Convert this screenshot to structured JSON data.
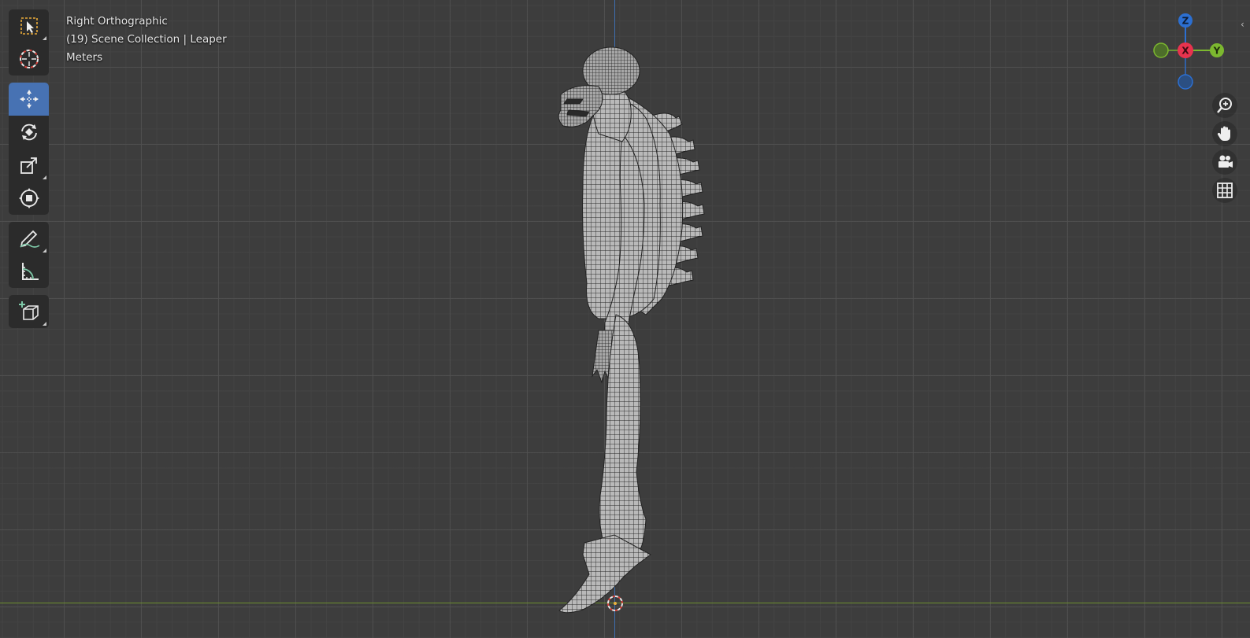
{
  "viewport": {
    "view_name": "Right Orthographic",
    "collection_info": "(19) Scene Collection | Leaper",
    "units": "Meters",
    "background": "#3d3d3d"
  },
  "toolbar": {
    "tools": [
      {
        "name": "select-box",
        "icon": "select-box-icon"
      },
      {
        "name": "cursor",
        "icon": "cursor-icon"
      },
      {
        "name": "move",
        "icon": "move-icon",
        "active": true
      },
      {
        "name": "rotate",
        "icon": "rotate-icon"
      },
      {
        "name": "scale",
        "icon": "scale-icon"
      },
      {
        "name": "transform",
        "icon": "transform-icon"
      },
      {
        "name": "annotate",
        "icon": "annotate-icon"
      },
      {
        "name": "measure",
        "icon": "measure-icon"
      },
      {
        "name": "add-cube",
        "icon": "add-cube-icon"
      }
    ],
    "active_color": "#4772b3"
  },
  "gizmo": {
    "z_label": "Z",
    "x_label": "X",
    "y_label": "Y",
    "colors": {
      "z": "#2c6fd1",
      "x": "#e8334e",
      "y": "#7cb82f"
    }
  },
  "nav_buttons": [
    "zoom-icon",
    "hand-pan-icon",
    "camera-icon",
    "grid-icon"
  ],
  "axis_colors": {
    "z": "#3e6fb0",
    "y": "#6e8f2e"
  }
}
